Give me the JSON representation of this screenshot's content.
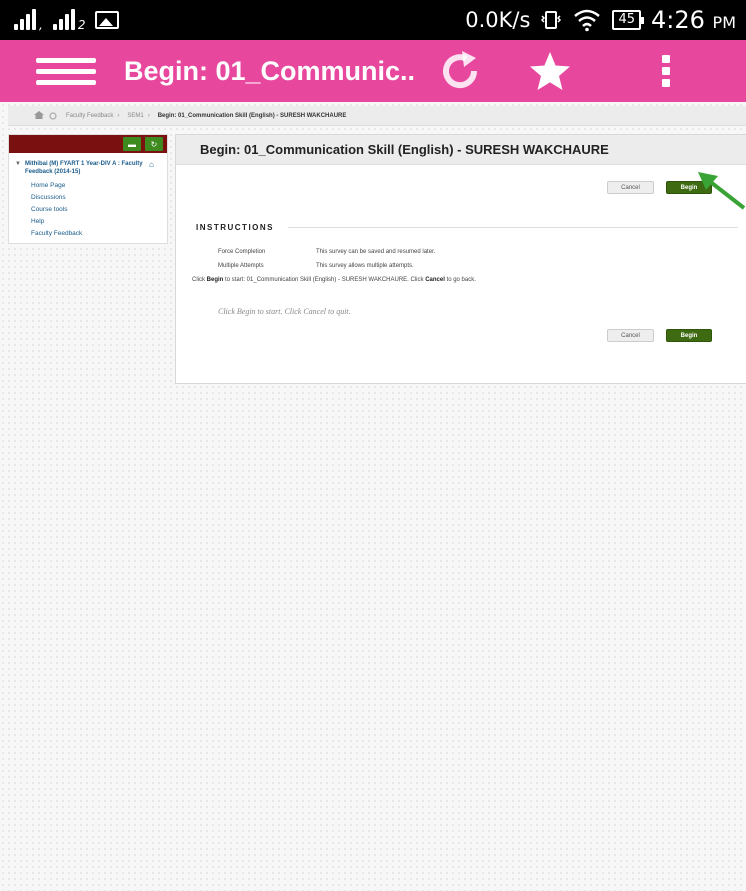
{
  "status_bar": {
    "signal1_sub": ",",
    "signal2_sub": "2",
    "net_speed": "0.0K/s",
    "battery": "45",
    "time": "4:26",
    "ampm": "PM"
  },
  "app_bar": {
    "title": "Begin: 01_Communic..",
    "color": "#e8479e"
  },
  "breadcrumb": {
    "items": [
      "Faculty Feedback",
      "SEM1"
    ],
    "current": "Begin: 01_Communication Skill (English) - SURESH WAKCHAURE"
  },
  "left_menu": {
    "course_title": "Mithibai (M) FYART 1 Year-DIV A : Faculty Feedback (2014-15)",
    "links": [
      "Home Page",
      "Discussions",
      "Course tools",
      "Help",
      "Faculty Feedback"
    ]
  },
  "panel": {
    "title": "Begin: 01_Communication Skill (English) - SURESH WAKCHAURE",
    "cancel_label": "Cancel",
    "begin_label": "Begin",
    "instructions_heading": "INSTRUCTIONS",
    "rows": [
      {
        "label": "Force Completion",
        "value": "This survey can be saved and resumed later."
      },
      {
        "label": "Multiple Attempts",
        "value": "This survey allows multiple attempts."
      }
    ],
    "click_line": {
      "prefix": "Click ",
      "begin_word": "Begin",
      "middle": " to start: 01_Communication Skill (English) - SURESH WAKCHAURE. Click ",
      "cancel_word": "Cancel",
      "suffix": " to go back."
    },
    "hint": "Click Begin to start. Click Cancel to quit."
  },
  "colors": {
    "begin_button": "#3e6b12",
    "menu_header": "#7b1010",
    "arrow": "#3aa335"
  }
}
